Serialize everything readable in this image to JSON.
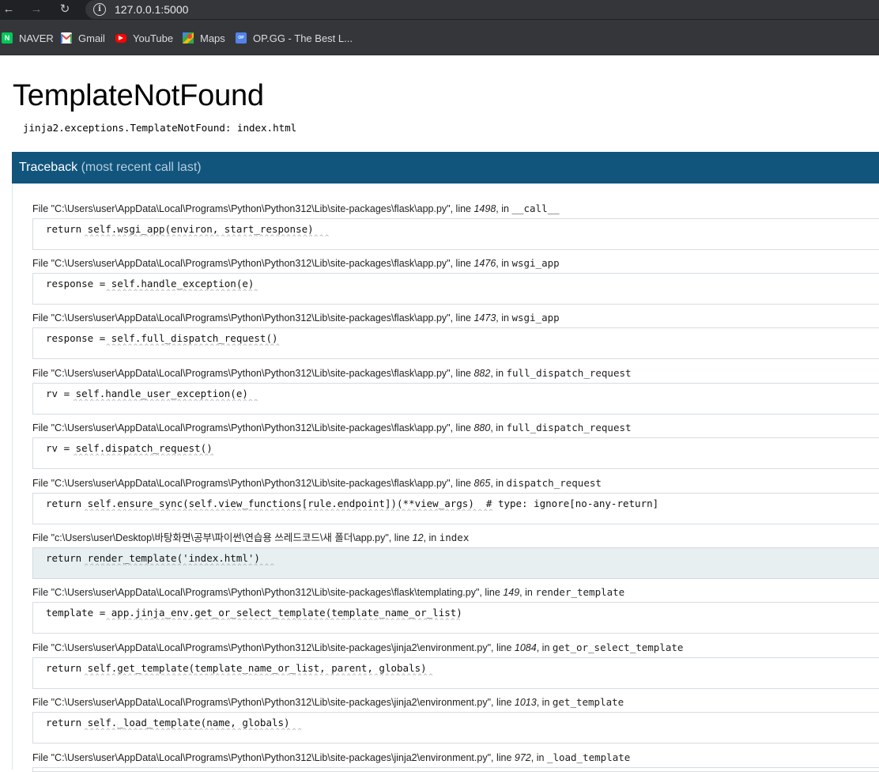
{
  "browser": {
    "url": "127.0.0.1:5000",
    "bookmarks": [
      {
        "label": "NAVER",
        "icon": "naver-icon"
      },
      {
        "label": "Gmail",
        "icon": "gmail-icon"
      },
      {
        "label": "YouTube",
        "icon": "youtube-icon"
      },
      {
        "label": "Maps",
        "icon": "maps-icon"
      },
      {
        "label": "OP.GG - The Best L...",
        "icon": "opgg-icon"
      }
    ]
  },
  "error": {
    "title": "TemplateNotFound",
    "message": "jinja2.exceptions.TemplateNotFound: index.html"
  },
  "traceback": {
    "title": "Traceback",
    "subtitle": "(most recent call last)",
    "frames": [
      {
        "file_prefix": "File ",
        "file": "\"C:\\Users\\user\\AppData\\Local\\Programs\\Python\\Python312\\Lib\\site-packages\\flask\\app.py\"",
        "line_label": ", line ",
        "line": "1498",
        "in_label": ", in ",
        "func": "__call__",
        "code": "return self.wsgi_app(environ, start_response)",
        "carets": "       ^^^^^^^^^^^^^^^^^^^^^^^^^^^^^^^^^^^^^^^^^^^^^"
      },
      {
        "file_prefix": "File ",
        "file": "\"C:\\Users\\user\\AppData\\Local\\Programs\\Python\\Python312\\Lib\\site-packages\\flask\\app.py\"",
        "line_label": ", line ",
        "line": "1476",
        "in_label": ", in ",
        "func": "wsgi_app",
        "code": "response = self.handle_exception(e)",
        "carets": "           ^^^^^^^^^^^^^^^^^^^^^^^^^^^^"
      },
      {
        "file_prefix": "File ",
        "file": "\"C:\\Users\\user\\AppData\\Local\\Programs\\Python\\Python312\\Lib\\site-packages\\flask\\app.py\"",
        "line_label": ", line ",
        "line": "1473",
        "in_label": ", in ",
        "func": "wsgi_app",
        "code": "response = self.full_dispatch_request()",
        "carets": "           ^^^^^^^^^^^^^^^^^^^^^^^^^^^^^^^^"
      },
      {
        "file_prefix": "File ",
        "file": "\"C:\\Users\\user\\AppData\\Local\\Programs\\Python\\Python312\\Lib\\site-packages\\flask\\app.py\"",
        "line_label": ", line ",
        "line": "882",
        "in_label": ", in ",
        "func": "full_dispatch_request",
        "code": "rv = self.handle_user_exception(e)",
        "carets": "     ^^^^^^^^^^^^^^^^^^^^^^^^^^^^^^^^^^"
      },
      {
        "file_prefix": "File ",
        "file": "\"C:\\Users\\user\\AppData\\Local\\Programs\\Python\\Python312\\Lib\\site-packages\\flask\\app.py\"",
        "line_label": ", line ",
        "line": "880",
        "in_label": ", in ",
        "func": "full_dispatch_request",
        "code": "rv = self.dispatch_request()",
        "carets": "     ^^^^^^^^^^^^^^^^^^^^^^^^^^"
      },
      {
        "file_prefix": "File ",
        "file": "\"C:\\Users\\user\\AppData\\Local\\Programs\\Python\\Python312\\Lib\\site-packages\\flask\\app.py\"",
        "line_label": ", line ",
        "line": "865",
        "in_label": ", in ",
        "func": "dispatch_request",
        "code": "return self.ensure_sync(self.view_functions[rule.endpoint])(**view_args)  # type: ignore[no-any-return]",
        "carets": "       ^^^^^^^^^^^^^^^^^^^^^^^^^^^^^^^^^^^^^^^^^^^^^^^^^^^^^^^^^^^^^^^^^^^^^^^^^^^"
      },
      {
        "file_prefix": "File ",
        "file": "\"c:\\Users\\user\\Desktop\\바탕화면\\공부\\파이썬\\연습용 쓰레드코드\\새 폴더\\app.py\"",
        "line_label": ", line ",
        "line": "12",
        "in_label": ", in ",
        "func": "index",
        "code": "return render_template('index.html')",
        "carets": "       ^^^^^^^^^^^^^^^^^^^^^^^^^^^^^^^^^^^",
        "current": true
      },
      {
        "file_prefix": "File ",
        "file": "\"C:\\Users\\user\\AppData\\Local\\Programs\\Python\\Python312\\Lib\\site-packages\\flask\\templating.py\"",
        "line_label": ", line ",
        "line": "149",
        "in_label": ", in ",
        "func": "render_template",
        "code": "template = app.jinja_env.get_or_select_template(template_name_or_list)",
        "carets": "           ^^^^^^^^^^^^^^^^^^^^^^^^^^^^^^^^^^^^^^^^^^^^^^^^^^^^^^^^^^^^^^^^^"
      },
      {
        "file_prefix": "File ",
        "file": "\"C:\\Users\\user\\AppData\\Local\\Programs\\Python\\Python312\\Lib\\site-packages\\jinja2\\environment.py\"",
        "line_label": ", line ",
        "line": "1084",
        "in_label": ", in ",
        "func": "get_or_select_template",
        "code": "return self.get_template(template_name_or_list, parent, globals)",
        "carets": "       ^^^^^^^^^^^^^^^^^^^^^^^^^^^^^^^^^^^^^^^^^^^^^^^^^^^^^^^^^^^^^^^^"
      },
      {
        "file_prefix": "File ",
        "file": "\"C:\\Users\\user\\AppData\\Local\\Programs\\Python\\Python312\\Lib\\site-packages\\jinja2\\environment.py\"",
        "line_label": ", line ",
        "line": "1013",
        "in_label": ", in ",
        "func": "get_template",
        "code": "return self._load_template(name, globals)",
        "carets": "       ^^^^^^^^^^^^^^^^^^^^^^^^^^^^^^^^^^^^^^^^"
      },
      {
        "file_prefix": "File ",
        "file": "\"C:\\Users\\user\\AppData\\Local\\Programs\\Python\\Python312\\Lib\\site-packages\\jinja2\\environment.py\"",
        "line_label": ", line ",
        "line": "972",
        "in_label": ", in ",
        "func": "_load_template",
        "code": "",
        "carets": ""
      }
    ]
  }
}
